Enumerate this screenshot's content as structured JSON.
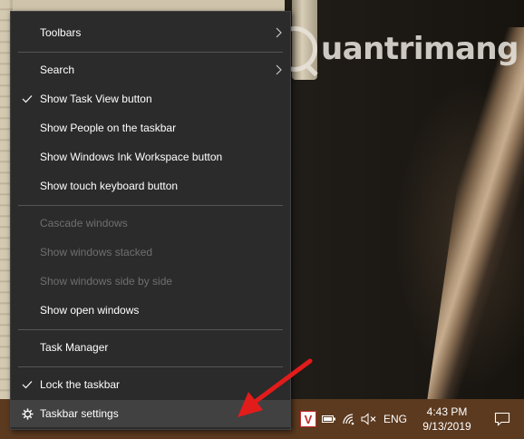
{
  "watermark": {
    "text": "uantrimang"
  },
  "menu": {
    "items": [
      {
        "label": "Toolbars",
        "checked": false,
        "disabled": false,
        "submenu": true
      },
      {
        "label": "Search",
        "checked": false,
        "disabled": false,
        "submenu": true
      },
      {
        "label": "Show Task View button",
        "checked": true,
        "disabled": false
      },
      {
        "label": "Show People on the taskbar",
        "checked": false,
        "disabled": false
      },
      {
        "label": "Show Windows Ink Workspace button",
        "checked": false,
        "disabled": false
      },
      {
        "label": "Show touch keyboard button",
        "checked": false,
        "disabled": false
      },
      {
        "label": "Cascade windows",
        "checked": false,
        "disabled": true
      },
      {
        "label": "Show windows stacked",
        "checked": false,
        "disabled": true
      },
      {
        "label": "Show windows side by side",
        "checked": false,
        "disabled": true
      },
      {
        "label": "Show open windows",
        "checked": false,
        "disabled": false
      },
      {
        "label": "Task Manager",
        "checked": false,
        "disabled": false
      },
      {
        "label": "Lock the taskbar",
        "checked": true,
        "disabled": false
      },
      {
        "label": "Taskbar settings",
        "checked": false,
        "disabled": false,
        "highlighted": true,
        "icon": "gear-icon"
      }
    ]
  },
  "taskbar": {
    "tray": {
      "app_icon_letter": "V",
      "icons": [
        "battery-icon",
        "wifi-icon",
        "volume-muted-icon"
      ],
      "language": "ENG",
      "time": "4:43 PM",
      "date": "9/13/2019",
      "notification_icon": "notification-icon"
    }
  },
  "colors": {
    "menu_bg": "#2b2b2b",
    "menu_hover": "#414141",
    "menu_text": "#ffffff",
    "menu_disabled_text": "#6f6f6f",
    "taskbar_bg": "#5c3a1f",
    "annotation_red": "#e21b1b"
  }
}
